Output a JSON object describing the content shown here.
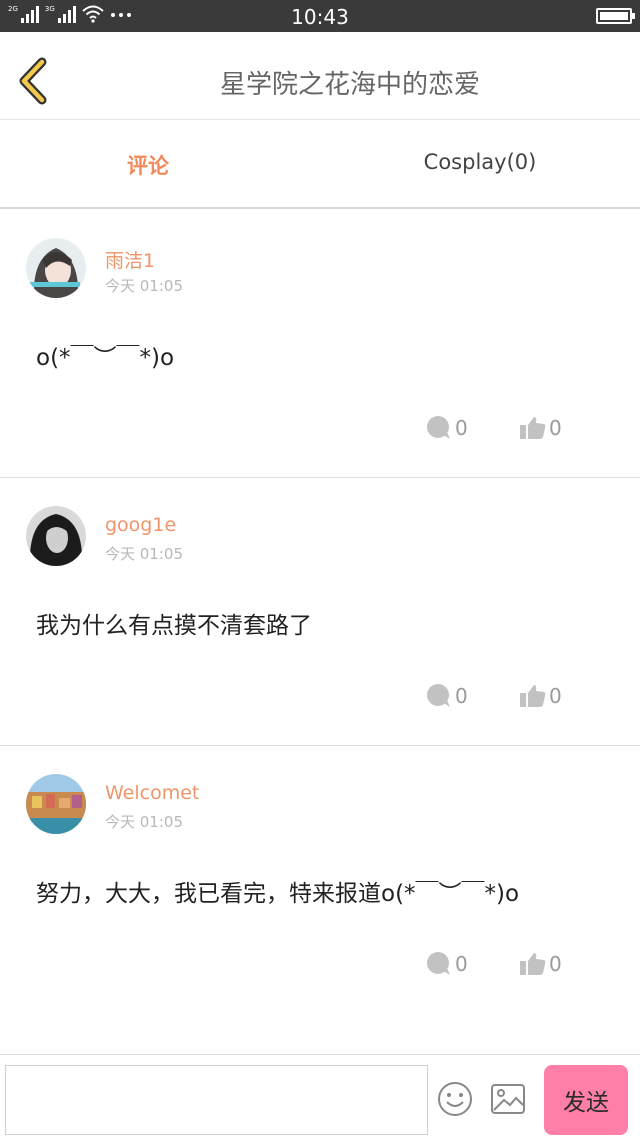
{
  "status_bar": {
    "time": "10:43",
    "signal1": "2G",
    "signal2": "3G"
  },
  "header": {
    "title": "星学院之花海中的恋爱"
  },
  "tabs": [
    {
      "label": "评论"
    },
    {
      "label": "Cosplay(0)"
    }
  ],
  "comments": [
    {
      "user": "雨洁1",
      "time": "今天 01:05",
      "text": "o(*￣︶￣*)o",
      "replies": "0",
      "likes": "0"
    },
    {
      "user": "goog1e",
      "time": "今天 01:05",
      "text": "我为什么有点摸不清套路了",
      "replies": "0",
      "likes": "0"
    },
    {
      "user": "Welcomet",
      "time": "今天 01:05",
      "text": "努力，大大，我已看完，特来报道o(*￣︶￣*)o",
      "replies": "0",
      "likes": "0"
    }
  ],
  "composer": {
    "value": "",
    "send_label": "发送"
  },
  "colors": {
    "accent": "#f08a5a",
    "send": "#ff7fa6",
    "status_bar": "#3a3a3a"
  }
}
